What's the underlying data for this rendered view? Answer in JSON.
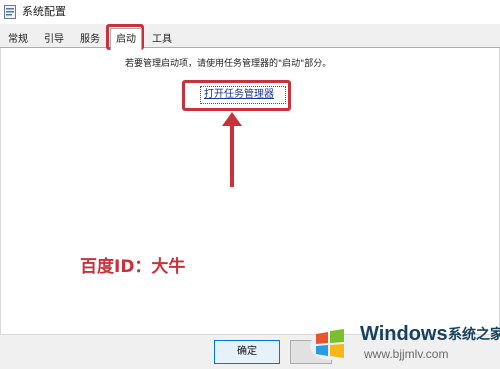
{
  "window": {
    "title": "系统配置"
  },
  "tabs": [
    {
      "label": "常规"
    },
    {
      "label": "引导"
    },
    {
      "label": "服务"
    },
    {
      "label": "启动",
      "active": true
    },
    {
      "label": "工具"
    }
  ],
  "startup": {
    "hint": "若要管理启动项，请使用任务管理器的\"启动\"部分。",
    "open_link": "打开任务管理器"
  },
  "annotation": {
    "text": "百度ID：大牛",
    "color": "#c9323b"
  },
  "buttons": {
    "ok": "确定"
  },
  "watermark": {
    "brand": "Windows",
    "brand_cn": "系统之家",
    "url": "www.bjjmlv.com"
  }
}
